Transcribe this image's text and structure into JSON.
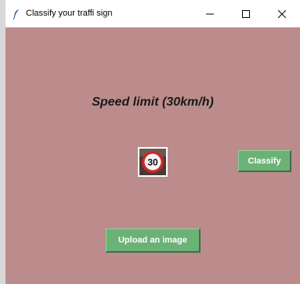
{
  "window": {
    "title": "Classify your traffi sign",
    "icon": "feather-icon",
    "controls": {
      "minimize": "minimize-icon",
      "maximize": "maximize-icon",
      "close": "close-icon"
    }
  },
  "main": {
    "result_text": "Speed limit (30km/h)",
    "sign_image": {
      "icon": "speed-limit-30-sign",
      "value": "30"
    },
    "classify_label": "Classify",
    "upload_label": "Upload an image"
  },
  "colors": {
    "background": "#bc8c8c",
    "button": "#6bb277",
    "button_text": "#ffffff",
    "result_text": "#1a1a1a"
  }
}
